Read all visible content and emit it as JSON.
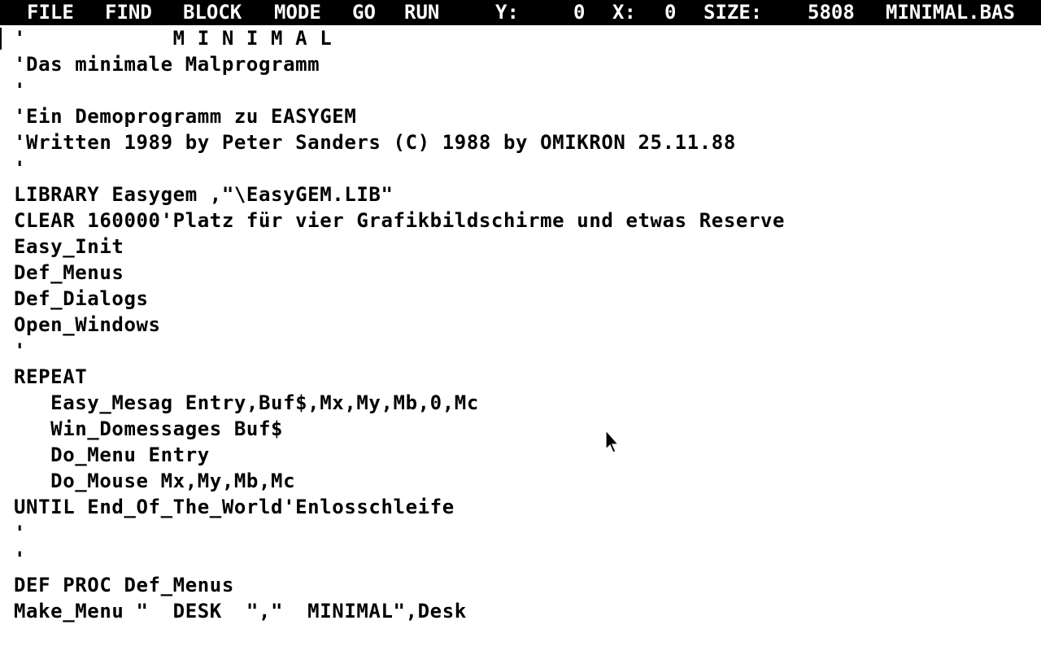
{
  "menubar": {
    "file": "FILE",
    "find": "FIND",
    "block": "BLOCK",
    "mode": "MODE",
    "go": "GO",
    "run": "RUN",
    "y_label": "Y:",
    "y_value": "0",
    "x_label": "X:",
    "x_value": "0",
    "size_label": "SIZE:",
    "size_value": "5808",
    "filename": "MINIMAL.BAS"
  },
  "editor": {
    "lines": [
      "'            M I N I M A L",
      "'Das minimale Malprogramm",
      "'",
      "'Ein Demoprogramm zu EASYGEM",
      "'Written 1989 by Peter Sanders (C) 1988 by OMIKRON 25.11.88",
      "'",
      "LIBRARY Easygem ,\"\\EasyGEM.LIB\"",
      "CLEAR 160000'Platz für vier Grafikbildschirme und etwas Reserve",
      "Easy_Init",
      "Def_Menus",
      "Def_Dialogs",
      "Open_Windows",
      "'",
      "REPEAT",
      "   Easy_Mesag Entry,Buf$,Mx,My,Mb,0,Mc",
      "   Win_Domessages Buf$",
      "   Do_Menu Entry",
      "   Do_Mouse Mx,My,Mb,Mc",
      "UNTIL End_Of_The_World'Enlosschleife",
      "'",
      "'",
      "DEF PROC Def_Menus",
      "Make_Menu \"  DESK  \",\"  MINIMAL\",Desk"
    ]
  },
  "pointer": {
    "icon": "arrow-pointer-icon"
  }
}
